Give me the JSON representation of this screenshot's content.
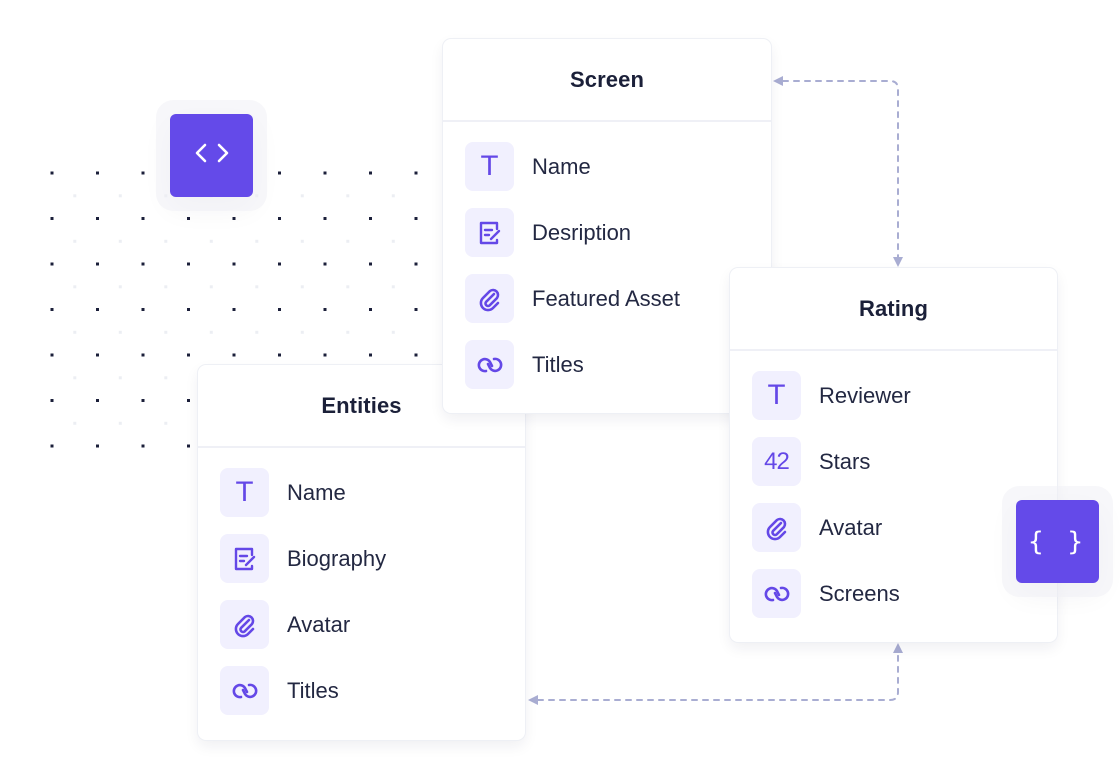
{
  "colors": {
    "accent": "#644AE9",
    "icon_tile_bg": "#F1F0FE",
    "icon_fg": "#6448E7",
    "text": "#232842",
    "connector": "#A9ADD2",
    "dot": "#1B1F3A"
  },
  "decor": {
    "code_tile": {
      "icon": "code-brackets-icon",
      "glyph": "< >"
    },
    "braces_tile": {
      "icon": "curly-braces-icon",
      "glyph": "{ }"
    }
  },
  "cards": {
    "screen": {
      "title": "Screen",
      "fields": [
        {
          "label": "Name",
          "icon": "text-icon",
          "glyph": "T"
        },
        {
          "label": "Desription",
          "icon": "rich-text-icon"
        },
        {
          "label": "Featured Asset",
          "icon": "attachment-icon"
        },
        {
          "label": "Titles",
          "icon": "link-icon"
        }
      ]
    },
    "rating": {
      "title": "Rating",
      "fields": [
        {
          "label": "Reviewer",
          "icon": "text-icon",
          "glyph": "T"
        },
        {
          "label": "Stars",
          "icon": "number-icon",
          "glyph": "42"
        },
        {
          "label": "Avatar",
          "icon": "attachment-icon"
        },
        {
          "label": "Screens",
          "icon": "link-icon"
        }
      ]
    },
    "entities": {
      "title": "Entities",
      "fields": [
        {
          "label": "Name",
          "icon": "text-icon",
          "glyph": "T"
        },
        {
          "label": "Biography",
          "icon": "rich-text-icon"
        },
        {
          "label": "Avatar",
          "icon": "attachment-icon"
        },
        {
          "label": "Titles",
          "icon": "link-icon"
        }
      ]
    }
  },
  "connectors": [
    {
      "from": "rating",
      "to": "screen",
      "style": "dashed",
      "arrows": "both"
    },
    {
      "from": "rating",
      "to": "entities",
      "style": "dashed",
      "arrows": "both"
    }
  ]
}
